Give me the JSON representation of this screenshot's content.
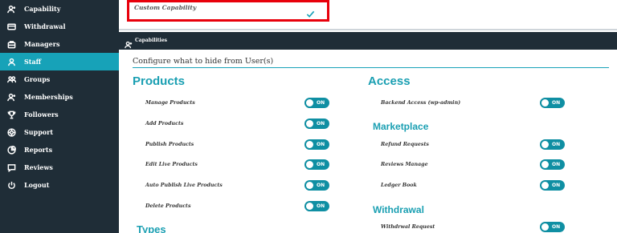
{
  "sidebar": {
    "items": [
      {
        "label": "Capability",
        "icon": "user-plus-icon"
      },
      {
        "label": "Withdrawal",
        "icon": "credit-card-icon"
      },
      {
        "label": "Managers",
        "icon": "briefcase-icon"
      },
      {
        "label": "Staff",
        "icon": "user-icon",
        "active": true
      },
      {
        "label": "Groups",
        "icon": "users-icon"
      },
      {
        "label": "Memberships",
        "icon": "user-plus-icon"
      },
      {
        "label": "Followers",
        "icon": "trophy-icon"
      },
      {
        "label": "Support",
        "icon": "lifebuoy-icon"
      },
      {
        "label": "Reports",
        "icon": "pie-chart-icon"
      },
      {
        "label": "Reviews",
        "icon": "comment-icon"
      },
      {
        "label": "Logout",
        "icon": "power-icon"
      }
    ]
  },
  "custom_capability": {
    "label": "Custom Capability",
    "checked": true
  },
  "capabilities": {
    "header": "Capabilities",
    "configure_text": "Configure what to hide from User(s)"
  },
  "products": {
    "title": "Products",
    "items": [
      {
        "label": "Manage Products",
        "toggle": "ON"
      },
      {
        "label": "Add Products",
        "toggle": "ON"
      },
      {
        "label": "Publish Products",
        "toggle": "ON"
      },
      {
        "label": "Edit Live Products",
        "toggle": "ON"
      },
      {
        "label": "Auto Publish Live Products",
        "toggle": "ON"
      },
      {
        "label": "Delete Products",
        "toggle": "ON"
      }
    ]
  },
  "types": {
    "title": "Types"
  },
  "access": {
    "title": "Access",
    "items": [
      {
        "label": "Backend Access (wp-admin)",
        "toggle": "ON"
      }
    ]
  },
  "marketplace": {
    "title": "Marketplace",
    "items": [
      {
        "label": "Refund Requests",
        "toggle": "ON"
      },
      {
        "label": "Reviews Manage",
        "toggle": "ON"
      },
      {
        "label": "Ledger Book",
        "toggle": "ON"
      }
    ]
  },
  "withdrawal": {
    "title": "Withdrawal",
    "items": [
      {
        "label": "Withdrwal Request",
        "toggle": "ON"
      }
    ]
  },
  "colors": {
    "sidebar_bg": "#1f2d37",
    "accent": "#17a2b8",
    "toggle_on": "#0f8fa3",
    "highlight_border": "#e8000b"
  }
}
